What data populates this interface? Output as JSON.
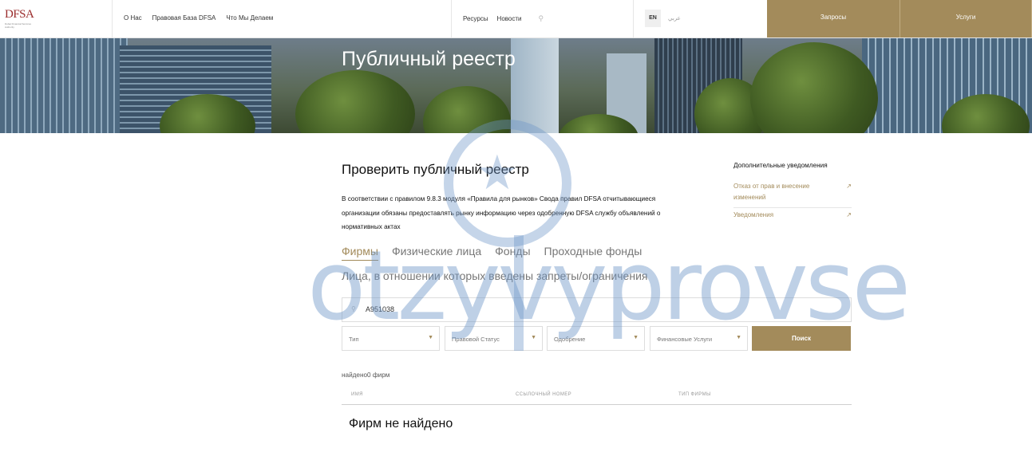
{
  "header": {
    "logo_text": "DFSA",
    "logo_sub": "Dubai Financial Services Authority",
    "nav_left": [
      "О Нас",
      "Правовая База DFSA",
      "Что Мы Делаем"
    ],
    "nav_mid": [
      "Ресурсы",
      "Новости"
    ],
    "lang_en": "EN",
    "lang_ar": "عربي",
    "btn_requests": "Запросы",
    "btn_services": "Услуги"
  },
  "hero": {
    "title": "Публичный реестр"
  },
  "main": {
    "title": "Проверить публичный реестр",
    "intro": "В соответствии с правилом 9.8.3 модуля «Правила для рынков» Свода правил DFSA отчитывающиеся организации обязаны предоставлять рынку информацию через одобренную DFSA службу объявлений о нормативных актах"
  },
  "sidebar": {
    "title": "Дополнительные уведомления",
    "links": [
      "Отказ от прав и внесение изменений",
      "Уведомления"
    ]
  },
  "tabs": [
    "Фирмы",
    "Физические лица",
    "Фонды",
    "Проходные фонды"
  ],
  "tab_second_row": "Лица, в отношении которых введены запреты/ограничения",
  "search": {
    "value": "A951038"
  },
  "filters": [
    "Тип",
    "Правовой Статус",
    "Одобрение",
    "Финансовые Услуги"
  ],
  "search_button": "Поиск",
  "results": {
    "found_text": "найдено0 фирм",
    "columns": [
      "ИМЯ",
      "ССЫЛОЧНЫЙ НОМЕР",
      "ТИП ФИРМЫ"
    ],
    "empty_text": "Фирм не найдено"
  },
  "watermark": "otzyvyprovse",
  "colors": {
    "accent_gold": "#a38b5b"
  }
}
